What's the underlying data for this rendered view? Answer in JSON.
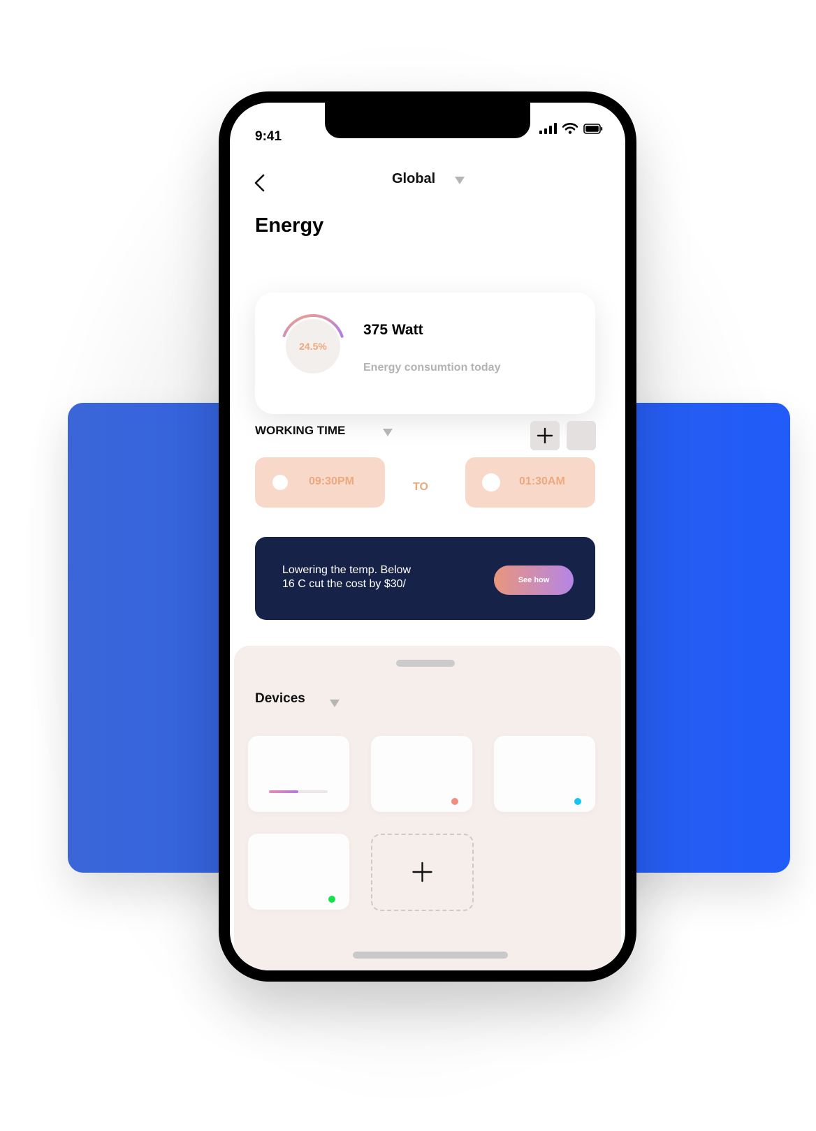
{
  "status_bar": {
    "time": "9:41",
    "signal_icon": "cellular-signal-icon",
    "wifi_icon": "wifi-icon",
    "battery_icon": "battery-icon"
  },
  "header": {
    "back_icon": "chevron-left-icon",
    "location_dropdown": "Global",
    "dropdown_icon": "triangle-down-icon"
  },
  "page": {
    "title": "Energy"
  },
  "energy_card": {
    "percent_label": "24.5%",
    "progress_fraction": 0.245,
    "value_label": "375 Watt",
    "description": "Energy consumtion today",
    "gradient_colors": [
      "#f0a48a",
      "#b07ae6"
    ]
  },
  "working_time": {
    "label": "WORKING TIME",
    "add_icon": "plus-icon",
    "start_time": "09:30PM",
    "separator": "TO",
    "end_time": "01:30AM"
  },
  "promo": {
    "line1": "Lowering the temp. Below",
    "line2": "16 C cut the cost by $30/",
    "button_label": "See how"
  },
  "devices": {
    "label": "Devices",
    "tiles": [
      {
        "type": "slider",
        "level": 0.5
      },
      {
        "type": "status",
        "status_color": "#ef8f80"
      },
      {
        "type": "status",
        "status_color": "#18c4f3"
      },
      {
        "type": "status",
        "status_color": "#15e34b"
      }
    ],
    "add_icon": "plus-icon"
  },
  "colors": {
    "accent_blue": "#215bf8",
    "promo_bg": "#172248",
    "time_pill_bg": "#f8d8c9",
    "time_text": "#eda87e",
    "sheet_bg": "#f6eeeb"
  }
}
